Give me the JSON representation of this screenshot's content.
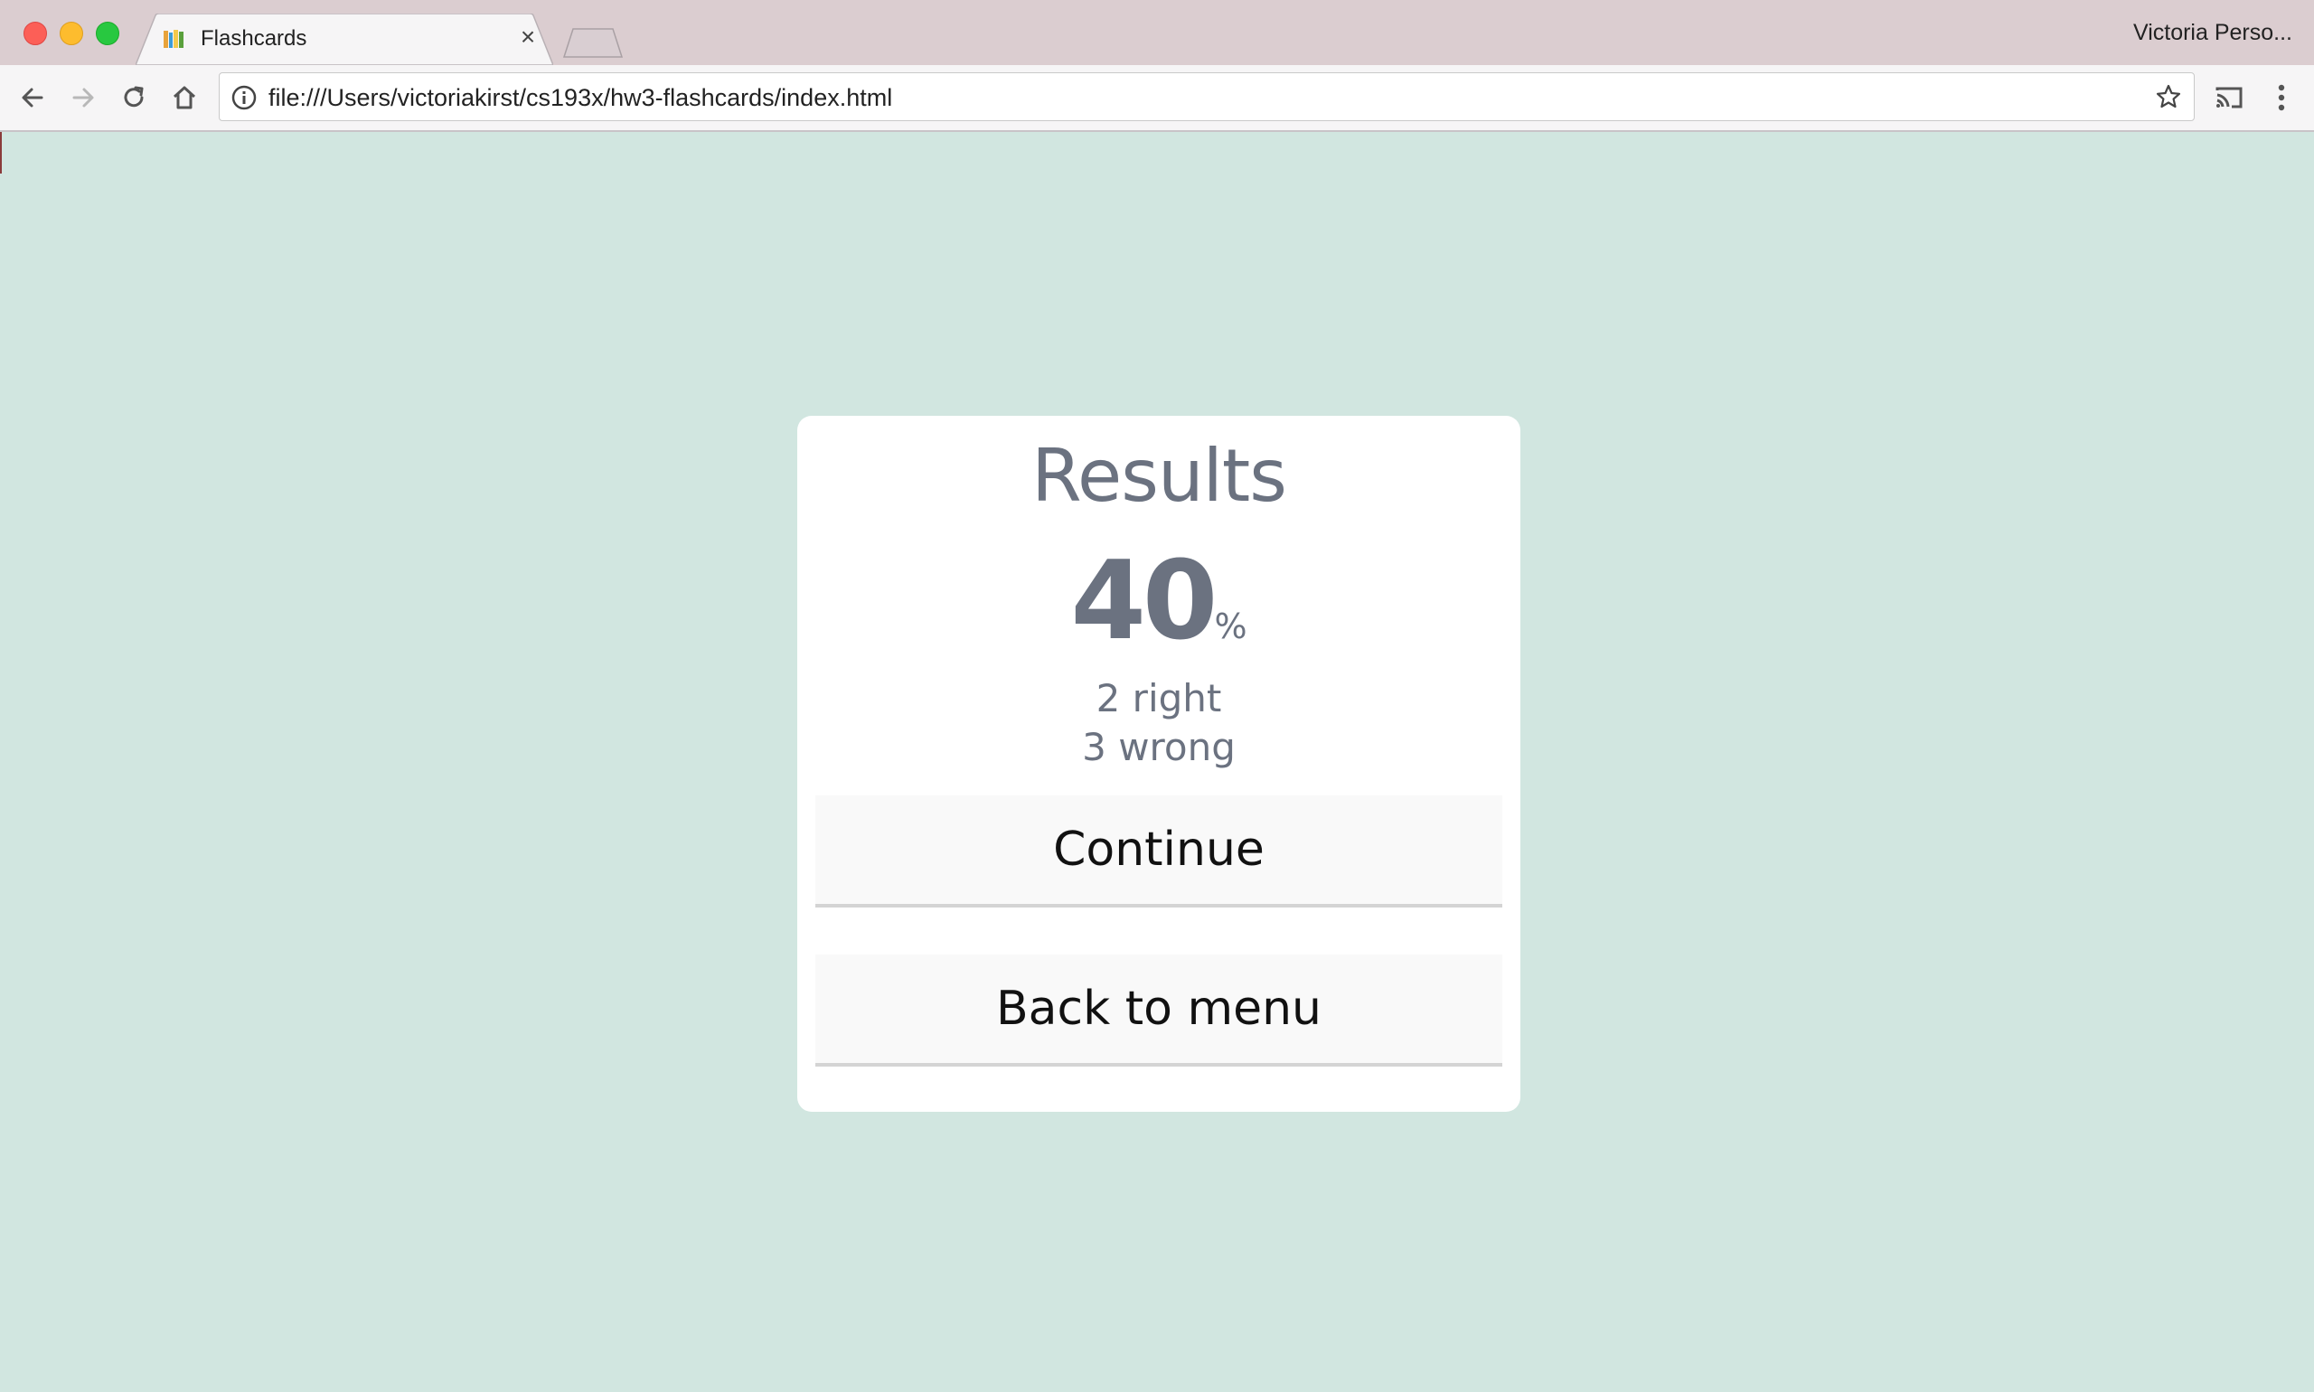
{
  "browser": {
    "tab": {
      "title": "Flashcards",
      "close_glyph": "×",
      "favicon": "books-icon"
    },
    "profile_name": "Victoria Perso...",
    "address_bar": {
      "url": "file:///Users/victoriakirst/cs193x/hw3-flashcards/index.html"
    },
    "toolbar_icons": [
      "back-arrow-icon",
      "forward-arrow-icon",
      "reload-icon",
      "home-icon",
      "info-icon",
      "star-icon",
      "cast-icon",
      "kebab-menu-icon"
    ]
  },
  "results": {
    "title": "Results",
    "percent": "40",
    "percent_sign": "%",
    "right_text": "2 right",
    "wrong_text": "3 wrong"
  },
  "buttons": {
    "continue_label": "Continue",
    "back_label": "Back to menu"
  },
  "colors": {
    "page_background": "#d1e6e0",
    "card_background": "#ffffff",
    "text_muted": "#6b7280",
    "button_background": "#f9f9f9"
  }
}
